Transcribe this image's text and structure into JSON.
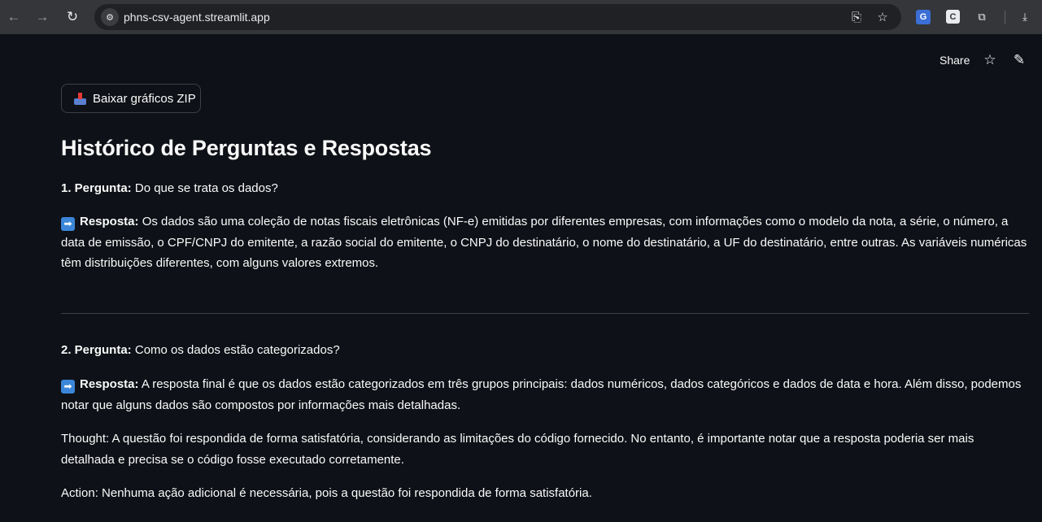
{
  "browser": {
    "url": "phns-csv-agent.streamlit.app",
    "back_icon": "arrow-left-icon",
    "forward_icon": "arrow-right-icon",
    "reload_icon": "reload-icon"
  },
  "header": {
    "share_label": "Share"
  },
  "main": {
    "download_button_label": "Baixar gráficos ZIP",
    "title": "Histórico de Perguntas e Respostas",
    "qa": [
      {
        "question_prefix": "1. Pergunta:",
        "question": "Do que se trata os dados?",
        "answer_prefix": "Resposta:",
        "answer": "Os dados são uma coleção de notas fiscais eletrônicas (NF-e) emitidas por diferentes empresas, com informações como o modelo da nota, a série, o número, a data de emissão, o CPF/CNPJ do emitente, a razão social do emitente, o CNPJ do destinatário, o nome do destinatário, a UF do destinatário, entre outras. As variáveis numéricas têm distribuições diferentes, com alguns valores extremos."
      },
      {
        "question_prefix": "2. Pergunta:",
        "question": "Como os dados estão categorizados?",
        "answer_prefix": "Resposta:",
        "answer": "A resposta final é que os dados estão categorizados em três grupos principais: dados numéricos, dados categóricos e dados de data e hora. Além disso, podemos notar que alguns dados são compostos por informações mais detalhadas.",
        "thought": "Thought: A questão foi respondida de forma satisfatória, considerando as limitações do código fornecido. No entanto, é importante notar que a resposta poderia ser mais detalhada e precisa se o código fosse executado corretamente.",
        "action": "Action: Nenhuma ação adicional é necessária, pois a questão foi respondida de forma satisfatória."
      }
    ]
  }
}
